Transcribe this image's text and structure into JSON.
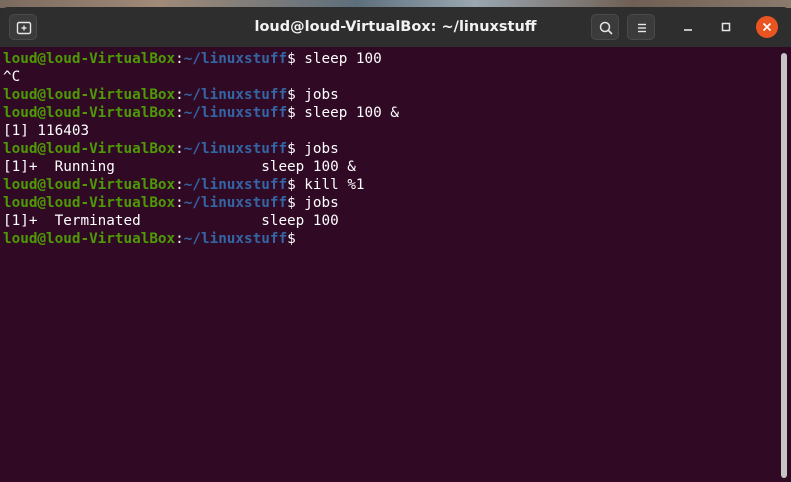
{
  "window": {
    "title": "loud@loud-VirtualBox: ~/linuxstuff",
    "new_tab_icon": "new-tab-icon",
    "search_icon": "search-icon",
    "menu_icon": "hamburger-menu-icon",
    "minimize_icon": "minimize-icon",
    "maximize_icon": "maximize-icon",
    "close_icon": "close-icon"
  },
  "colors": {
    "terminal_bg": "#300a24",
    "prompt_user": "#4e9a06",
    "prompt_path": "#3465a4",
    "close_button": "#e95420"
  },
  "terminal": {
    "lines": [
      {
        "user": "loud@loud-VirtualBox",
        "sep": ":",
        "path": "~/linuxstuff",
        "tail": "$ sleep 100"
      },
      {
        "text": "^C"
      },
      {
        "user": "loud@loud-VirtualBox",
        "sep": ":",
        "path": "~/linuxstuff",
        "tail": "$ jobs"
      },
      {
        "user": "loud@loud-VirtualBox",
        "sep": ":",
        "path": "~/linuxstuff",
        "tail": "$ sleep 100 &"
      },
      {
        "text": "[1] 116403"
      },
      {
        "user": "loud@loud-VirtualBox",
        "sep": ":",
        "path": "~/linuxstuff",
        "tail": "$ jobs"
      },
      {
        "text": "[1]+  Running                 sleep 100 &"
      },
      {
        "user": "loud@loud-VirtualBox",
        "sep": ":",
        "path": "~/linuxstuff",
        "tail": "$ kill %1"
      },
      {
        "user": "loud@loud-VirtualBox",
        "sep": ":",
        "path": "~/linuxstuff",
        "tail": "$ jobs"
      },
      {
        "text": "[1]+  Terminated              sleep 100"
      },
      {
        "user": "loud@loud-VirtualBox",
        "sep": ":",
        "path": "~/linuxstuff",
        "tail": "$"
      }
    ]
  }
}
